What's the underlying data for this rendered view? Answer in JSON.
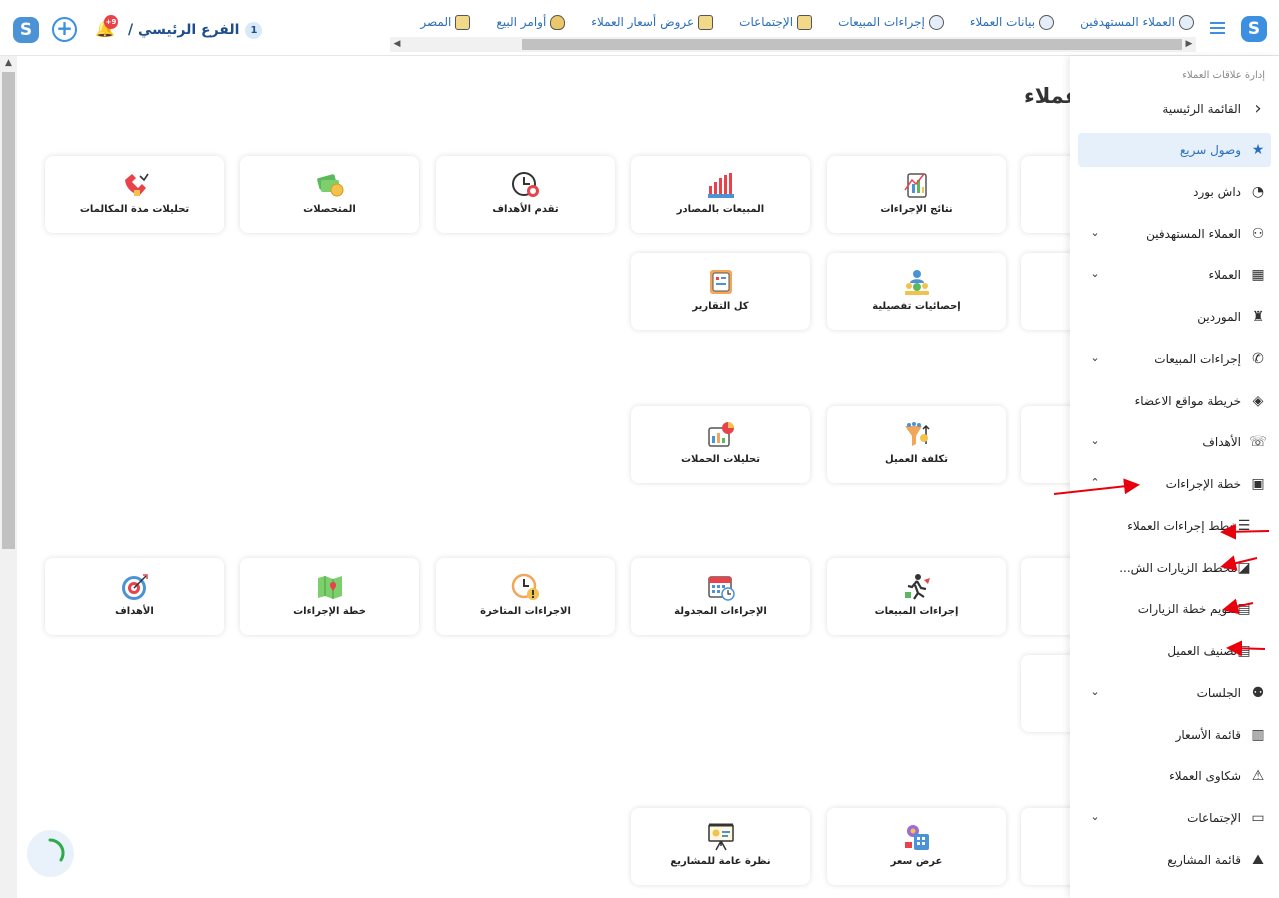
{
  "header": {
    "branch_label": "الفرع الرئيسي /",
    "branch_number": "1",
    "notification_count": "+9",
    "nav_links": [
      {
        "label": "العملاء المستهدفين",
        "icon": "users-icon"
      },
      {
        "label": "بيانات العملاء",
        "icon": "user-data-icon"
      },
      {
        "label": "إجراءات المبيعات",
        "icon": "phone-icon"
      },
      {
        "label": "الإجتماعات",
        "icon": "monitor-icon"
      },
      {
        "label": "عروض أسعار العملاء",
        "icon": "price-offer-icon"
      },
      {
        "label": "أوامر البيع",
        "icon": "money-bag-icon"
      },
      {
        "label": "المصر",
        "icon": "laptop-icon"
      }
    ]
  },
  "page": {
    "title": "عملاء"
  },
  "cards": [
    {
      "label": "تحليلات مدة المكالمات",
      "icon": "call-duration-icon"
    },
    {
      "label": "المتحصلات",
      "icon": "cash-icon"
    },
    {
      "label": "تقدم الأهداف",
      "icon": "goal-progress-icon"
    },
    {
      "label": "المبيعات بالمصادر",
      "icon": "sales-sources-icon"
    },
    {
      "label": "نتائج الإجراءات",
      "icon": "action-results-icon"
    },
    {
      "label": "كل التقارير",
      "icon": "all-reports-icon"
    },
    {
      "label": "إحصائيات تفصيلية",
      "icon": "detailed-stats-icon"
    },
    {
      "label": "تحليلات الحملات",
      "icon": "campaign-analytics-icon"
    },
    {
      "label": "تكلفة العميل",
      "icon": "customer-cost-icon"
    },
    {
      "label": "الأهداف",
      "icon": "target-icon"
    },
    {
      "label": "خطة الإجراءات",
      "icon": "action-plan-icon"
    },
    {
      "label": "الاجراءات المتاخرة",
      "icon": "late-actions-icon"
    },
    {
      "label": "الإجراءات المجدولة",
      "icon": "scheduled-actions-icon"
    },
    {
      "label": "إجراءات المبيعات",
      "icon": "sales-actions-icon"
    },
    {
      "label": "نظرة عامة للمشاريع",
      "icon": "projects-overview-icon"
    },
    {
      "label": "عرض سعر",
      "icon": "price-quote-icon"
    }
  ],
  "sidebar": {
    "title": "إدارة علاقات العملاء",
    "items": [
      {
        "label": "القائمة الرئيسية",
        "icon": "chevron-left-icon"
      },
      {
        "label": "وصول سريع",
        "icon": "star-icon"
      },
      {
        "label": "داش بورد",
        "icon": "dashboard-gauge-icon"
      },
      {
        "label": "العملاء المستهدفين",
        "icon": "users-icon"
      },
      {
        "label": "العملاء",
        "icon": "building-icon"
      },
      {
        "label": "الموردين",
        "icon": "supplier-icon"
      },
      {
        "label": "إجراءات المبيعات",
        "icon": "phone-icon"
      },
      {
        "label": "خريطة مواقع الاعضاء",
        "icon": "location-icon"
      },
      {
        "label": "الأهداف",
        "icon": "telephone-icon"
      },
      {
        "label": "خطة الإجراءات",
        "icon": "calendar-gear-icon"
      },
      {
        "label": "خطط إجراءات العملاء",
        "icon": "list-icon"
      },
      {
        "label": "مخطط الزيارات الش...",
        "icon": "chart-icon"
      },
      {
        "label": "تقويم خطة الزيارات",
        "icon": "calendar-icon"
      },
      {
        "label": "تصنيف العميل",
        "icon": "calendar-grid-icon"
      },
      {
        "label": "الجلسات",
        "icon": "group-icon"
      },
      {
        "label": "قائمة الأسعار",
        "icon": "price-list-icon"
      },
      {
        "label": "شكاوى العملاء",
        "icon": "warning-icon"
      },
      {
        "label": "الإجتماعات",
        "icon": "video-icon"
      },
      {
        "label": "قائمة المشاريع",
        "icon": "projects-icon"
      }
    ]
  },
  "colors": {
    "accent": "#3d8fe0",
    "active_bg": "#e5f0fb",
    "annotation": "#e8000d"
  }
}
